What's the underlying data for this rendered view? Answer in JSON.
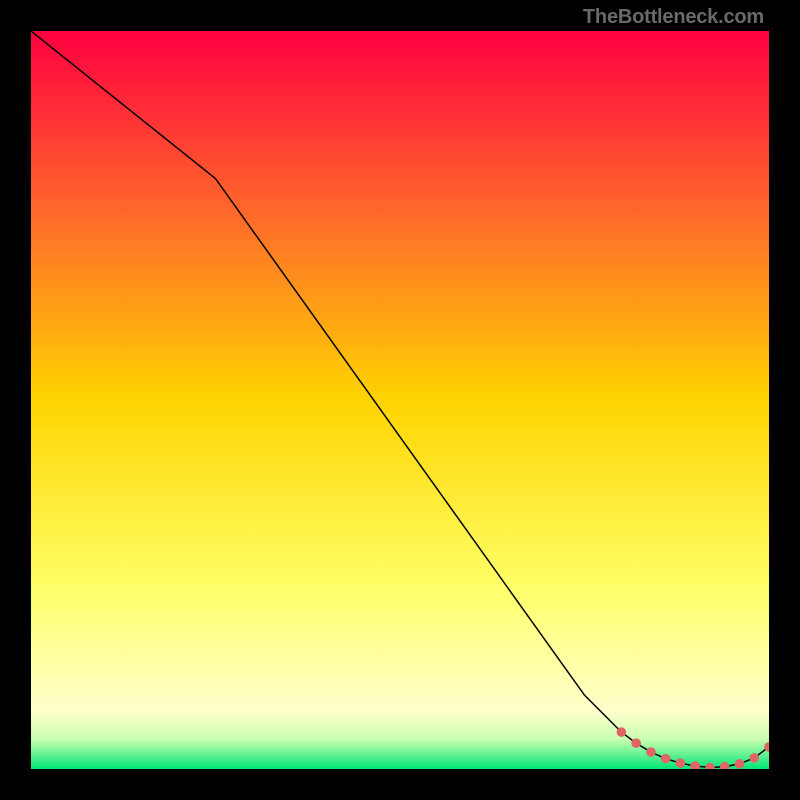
{
  "attribution": "TheBottleneck.com",
  "colors": {
    "background_black": "#000000",
    "curve_stroke": "#000000",
    "marker_fill": "#e06666",
    "gradient_stops": [
      {
        "offset": "0%",
        "color": "#ff0040"
      },
      {
        "offset": "25%",
        "color": "#ff6a2a"
      },
      {
        "offset": "50%",
        "color": "#ffd400"
      },
      {
        "offset": "75%",
        "color": "#ffff66"
      },
      {
        "offset": "92%",
        "color": "#ffffcc"
      },
      {
        "offset": "96%",
        "color": "#c9ffb0"
      },
      {
        "offset": "100%",
        "color": "#00e676"
      }
    ]
  },
  "chart_data": {
    "type": "line",
    "title": "",
    "xlabel": "",
    "ylabel": "",
    "xlim": [
      0,
      100
    ],
    "ylim": [
      0,
      100
    ],
    "note": "y represents bottleneck percentage (100 = worst/red at top, 0 = best/green at bottom). Curve is a single black line; salmon markers appear only near the minimum.",
    "series": [
      {
        "name": "bottleneck-curve",
        "x": [
          0,
          5,
          10,
          15,
          20,
          25,
          30,
          35,
          40,
          45,
          50,
          55,
          60,
          65,
          70,
          75,
          80,
          82,
          84,
          86,
          88,
          90,
          92,
          94,
          96,
          98,
          100
        ],
        "y": [
          100,
          96,
          92,
          88,
          84,
          80,
          73,
          66,
          59,
          52,
          45,
          38,
          31,
          24,
          17,
          10,
          5,
          3.5,
          2.3,
          1.4,
          0.8,
          0.4,
          0.2,
          0.3,
          0.7,
          1.5,
          3
        ]
      }
    ],
    "markers": {
      "name": "highlighted-points",
      "color": "#e06666",
      "x": [
        80,
        82,
        84,
        86,
        88,
        90,
        92,
        94,
        96,
        98,
        100
      ],
      "y": [
        5,
        3.5,
        2.3,
        1.4,
        0.8,
        0.4,
        0.2,
        0.3,
        0.7,
        1.5,
        3
      ]
    }
  }
}
